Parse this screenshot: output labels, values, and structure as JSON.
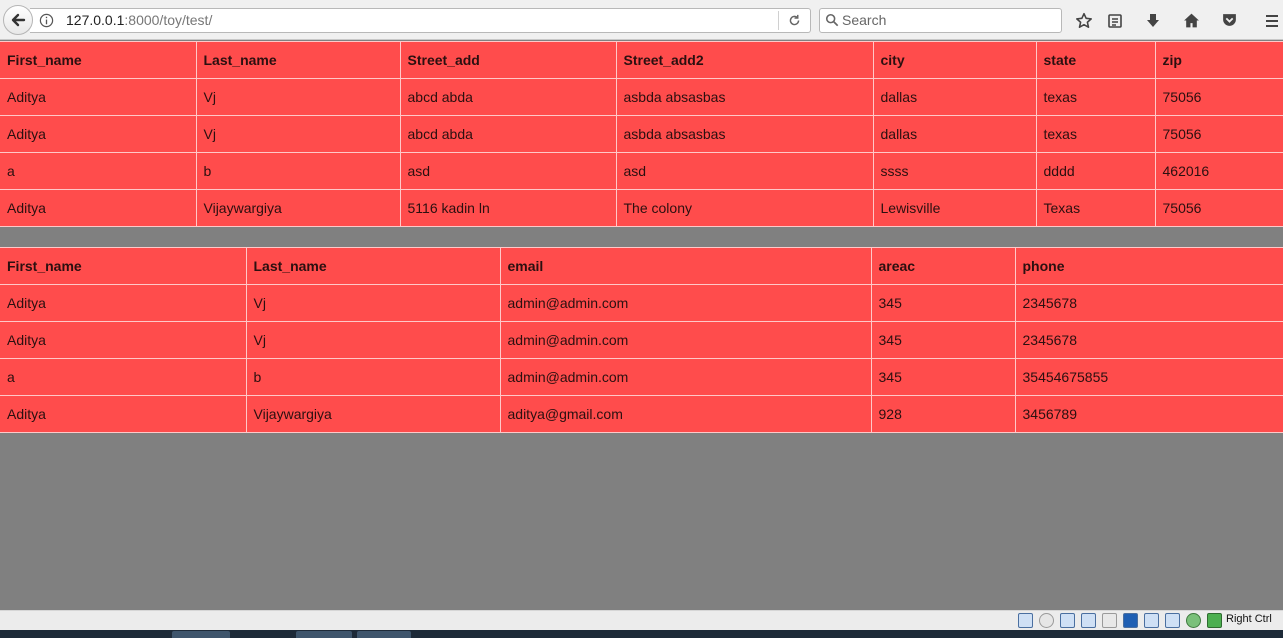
{
  "browser": {
    "url_host": "127.0.0.1",
    "url_rest": ":8000/toy/test/",
    "search_placeholder": "Search",
    "icons": [
      "back-arrow-icon",
      "info-icon",
      "reload-icon",
      "search-icon",
      "bookmark-star-icon",
      "reading-list-icon",
      "download-icon",
      "home-icon",
      "pocket-icon",
      "menu-icon"
    ]
  },
  "address_table": {
    "headers": [
      "First_name",
      "Last_name",
      "Street_add",
      "Street_add2",
      "city",
      "state",
      "zip"
    ],
    "rows": [
      [
        "Aditya",
        "Vj",
        "abcd abda",
        "asbda absasbas",
        "dallas",
        "texas",
        "75056"
      ],
      [
        "Aditya",
        "Vj",
        "abcd abda",
        "asbda absasbas",
        "dallas",
        "texas",
        "75056"
      ],
      [
        "a",
        "b",
        "asd",
        "asd",
        "ssss",
        "dddd",
        "462016"
      ],
      [
        "Aditya",
        "Vijaywargiya",
        "5116 kadin ln",
        "The colony",
        "Lewisville",
        "Texas",
        "75056"
      ]
    ]
  },
  "contact_table": {
    "headers": [
      "First_name",
      "Last_name",
      "email",
      "areac",
      "phone"
    ],
    "rows": [
      [
        "Aditya",
        "Vj",
        "admin@admin.com",
        "345",
        "2345678"
      ],
      [
        "Aditya",
        "Vj",
        "admin@admin.com",
        "345",
        "2345678"
      ],
      [
        "a",
        "b",
        "admin@admin.com",
        "345",
        "35454675855"
      ],
      [
        "Aditya",
        "Vijaywargiya",
        "aditya@gmail.com",
        "928",
        "3456789"
      ]
    ]
  },
  "system_tray": {
    "host_key_label": "Right Ctrl"
  },
  "colors": {
    "table_background": "#ff4c4c",
    "page_background": "#808080"
  }
}
